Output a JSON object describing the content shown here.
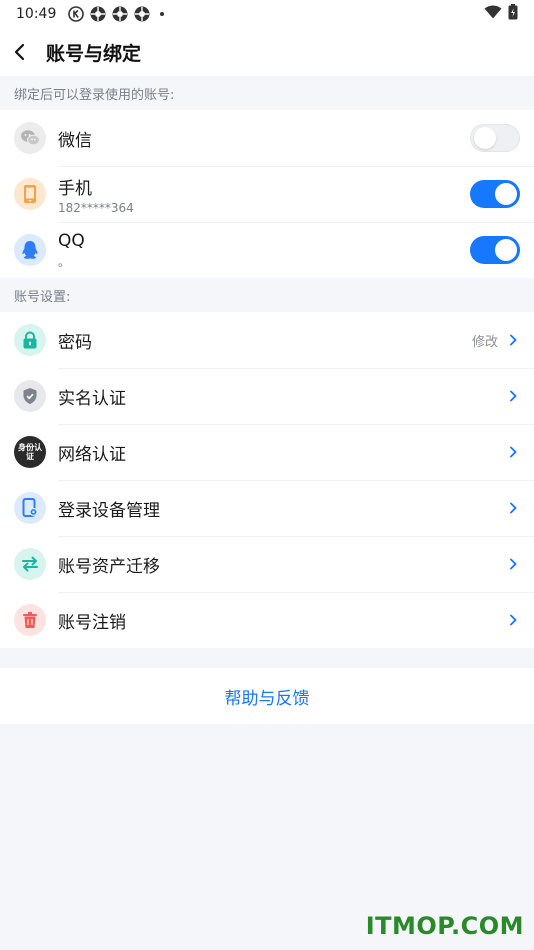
{
  "status_bar": {
    "time": "10:49"
  },
  "header": {
    "title": "账号与绑定"
  },
  "binding": {
    "section_label": "绑定后可以登录使用的账号:",
    "items": [
      {
        "label": "微信",
        "sub": "",
        "toggle": "off",
        "icon": "wechat-icon"
      },
      {
        "label": "手机",
        "sub": "182*****364",
        "toggle": "on",
        "icon": "phone-icon"
      },
      {
        "label": "QQ",
        "sub": "。",
        "toggle": "on",
        "icon": "qq-icon"
      }
    ]
  },
  "settings": {
    "section_label": "账号设置:",
    "items": [
      {
        "label": "密码",
        "value": "修改",
        "icon": "lock-icon"
      },
      {
        "label": "实名认证",
        "value": "",
        "icon": "shield-icon"
      },
      {
        "label": "网络认证",
        "value": "",
        "icon": "identity-badge-icon",
        "badge_text": "身份认证"
      },
      {
        "label": "登录设备管理",
        "value": "",
        "icon": "device-icon"
      },
      {
        "label": "账号资产迁移",
        "value": "",
        "icon": "transfer-arrows-icon"
      },
      {
        "label": "账号注销",
        "value": "",
        "icon": "trash-icon"
      }
    ]
  },
  "footer": {
    "help_label": "帮助与反馈"
  },
  "watermark": "ITMOP.COM",
  "colors": {
    "accent": "#1677ff",
    "toggle_off": "#eef0f4",
    "background": "#f4f6f9"
  }
}
